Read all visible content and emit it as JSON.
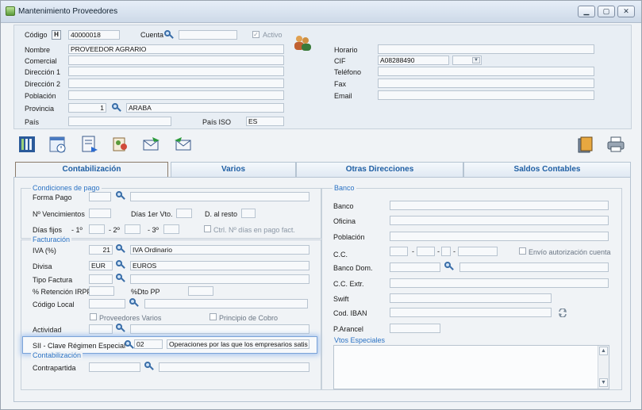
{
  "window": {
    "title": "Mantenimiento Proveedores"
  },
  "header": {
    "codigo_label": "Código",
    "h_button": "H",
    "codigo_value": "40000018",
    "cuenta_label": "Cuenta",
    "cuenta_value": "",
    "activo_label": "Activo",
    "nombre_label": "Nombre",
    "nombre_value": "PROVEEDOR AGRARIO",
    "comercial_label": "Comercial",
    "direccion1_label": "Dirección 1",
    "direccion2_label": "Dirección 2",
    "poblacion_label": "Población",
    "provincia_label": "Provincia",
    "provincia_code": "1",
    "provincia_name": "ARABA",
    "pais_label": "País",
    "pais_iso_label": "País ISO",
    "pais_iso_value": "ES",
    "horario_label": "Horario",
    "cif_label": "CIF",
    "cif_value": "A08288490",
    "telefono_label": "Teléfono",
    "fax_label": "Fax",
    "email_label": "Email"
  },
  "tabs": [
    "Contabilización",
    "Varios",
    "Otras Direcciones",
    "Saldos Contables"
  ],
  "left": {
    "condiciones_title": "Condiciones de pago",
    "forma_pago_label": "Forma Pago",
    "n_venc_label": "Nº Vencimientos",
    "dias_1er_label": "Días 1er Vto.",
    "d_al_resto_label": "D. al resto",
    "dias_fijos_label": "Días fijos",
    "f1_label": "- 1º",
    "f2_label": "- 2º",
    "f3_label": "- 3º",
    "ctrl_dias_label": "Ctrl. Nº días en pago fact.",
    "facturacion_title": "Facturación",
    "iva_label": "IVA (%)",
    "iva_code": "21",
    "iva_name": "IVA Ordinario",
    "divisa_label": "Divisa",
    "divisa_code": "EUR",
    "divisa_name": "EUROS",
    "tipo_factura_label": "Tipo Factura",
    "retencion_label": "% Retención IRPF",
    "dto_pp_label": "%Dto PP",
    "codigo_local_label": "Código Local",
    "prov_varios_label": "Proveedores Varios",
    "principio_cobro_label": "Principio de Cobro",
    "actividad_label": "Actividad",
    "sii_label": "SII - Clave Régimen Especial",
    "sii_code": "02",
    "sii_desc": "Operaciones por las que los empresarios satis",
    "contab_title": "Contabilización",
    "contrapartida_label": "Contrapartida"
  },
  "right": {
    "banco_title": "Banco",
    "banco_label": "Banco",
    "oficina_label": "Oficina",
    "poblacion_label": "Población",
    "cc_label": "C.C.",
    "envio_label": "Envío autorización cuenta",
    "banco_dom_label": "Banco Dom.",
    "cc_extr_label": "C.C. Extr.",
    "swift_label": "Swift",
    "iban_label": "Cod. IBAN",
    "parancel_label": "P.Arancel",
    "vtos_title": "Vtos Especiales"
  }
}
